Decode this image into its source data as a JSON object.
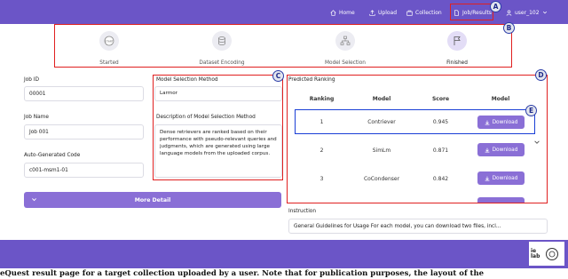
{
  "nav": {
    "home": "Home",
    "upload": "Upload",
    "collection": "Collection",
    "job_results": "Job/Results",
    "user": "user_102"
  },
  "markers": {
    "a": "A",
    "b": "B",
    "c": "C",
    "d": "D",
    "e": "E"
  },
  "steps": [
    {
      "label": "Started",
      "icon": "start-icon"
    },
    {
      "label": "Dataset Encoding",
      "icon": "database-icon"
    },
    {
      "label": "Model Selection",
      "icon": "network-icon"
    },
    {
      "label": "Finished",
      "icon": "finish-flag-icon"
    }
  ],
  "job": {
    "id_label": "Job ID",
    "id_value": "00001",
    "name_label": "Job Name",
    "name_value": "Job 001",
    "code_label": "Auto-Generated Code",
    "code_value": "c001-msm1-01",
    "more_detail": "More Detail"
  },
  "method": {
    "label": "Model Selection Method",
    "value": "Larmor",
    "desc_label": "Description of Model Selection Method",
    "desc_value": "Dense retrievers are ranked based on their performance with pseudo-relevant queries and judgments, which are generated using large language models from the uploaded corpus."
  },
  "ranking": {
    "title": "Predicted Ranking",
    "headers": [
      "Ranking",
      "Model",
      "Score",
      "Model"
    ],
    "rows": [
      {
        "rank": "1",
        "model": "Contriever",
        "score": "0.945",
        "action": "Download"
      },
      {
        "rank": "2",
        "model": "SimLm",
        "score": "0.871",
        "action": "Download"
      },
      {
        "rank": "3",
        "model": "CoCondenser",
        "score": "0.842",
        "action": "Download"
      }
    ]
  },
  "instruction": {
    "label": "Instruction",
    "value": "General Guidelines for Usage  For each model, you can download two files, incl..."
  },
  "footer": {
    "logo_text": "ie lab"
  },
  "caption": "eQuest result page for a target collection uploaded by a user. Note that for publication purposes, the layout of the",
  "colors": {
    "brand": "#6b55c7",
    "button": "#8a6fd6",
    "annotation_red": "#e02020",
    "annotation_blue": "#1a3fd6"
  }
}
